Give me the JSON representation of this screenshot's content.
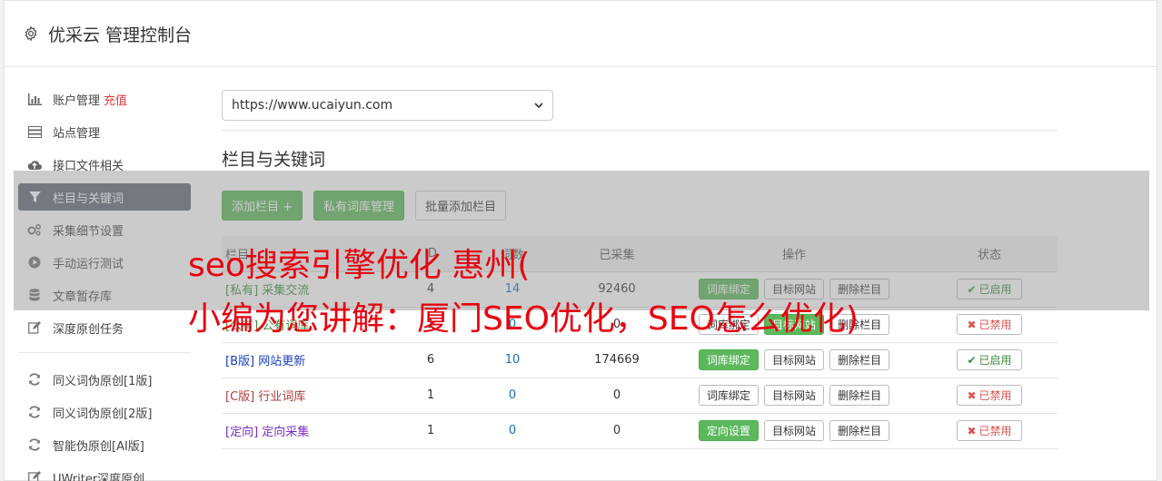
{
  "header": {
    "title": "优采云 管理控制台",
    "icon": "gear-icon"
  },
  "sidebar": {
    "items": [
      {
        "label": "账户管理",
        "extra": "充值",
        "icon": "bar-chart-icon"
      },
      {
        "label": "站点管理",
        "icon": "server-icon"
      },
      {
        "label": "接口文件相关",
        "icon": "cloud-upload-icon"
      },
      {
        "label": "栏目与关键词",
        "icon": "filter-icon",
        "active": true
      },
      {
        "label": "采集细节设置",
        "icon": "cogs-icon"
      },
      {
        "label": "手动运行测试",
        "icon": "play-circle-icon"
      },
      {
        "label": "文章暂存库",
        "icon": "database-icon"
      },
      {
        "label": "深度原创任务",
        "icon": "edit-icon"
      }
    ],
    "items2": [
      {
        "label": "同义词伪原创[1版]",
        "icon": "refresh-icon"
      },
      {
        "label": "同义词伪原创[2版]",
        "icon": "refresh-icon"
      },
      {
        "label": "智能伪原创[AI版]",
        "icon": "refresh-icon"
      },
      {
        "label": "UWriter深度原创",
        "icon": "edit-icon"
      }
    ]
  },
  "main": {
    "site_select": "https://www.ucaiyun.com",
    "section_title": "栏目与关键词",
    "buttons": {
      "add_column": "添加栏目 +",
      "private_lib": "私有词库管理",
      "batch_add": "批量添加栏目"
    },
    "table": {
      "headers": {
        "name": "栏目",
        "id": "ID",
        "count": "词数",
        "collected": "已采集",
        "ops": "操作",
        "status": "状态"
      },
      "rows": [
        {
          "tag": "[私有]",
          "name": "采集交流",
          "id": "4",
          "count": "14",
          "collected": "92460",
          "op1": "词库绑定",
          "op2": "目标网站",
          "op3": "删除栏目",
          "status": "已启用"
        },
        {
          "tag": "[公有]",
          "name": "公有词库",
          "id": "1",
          "count": "0",
          "collected": "0",
          "op1": "词库绑定",
          "op2": "目标网站",
          "op3": "删除栏目",
          "status": "已禁用"
        },
        {
          "tag": "[B版]",
          "name": "网站更新",
          "id": "6",
          "count": "10",
          "collected": "174669",
          "op1": "词库绑定",
          "op2": "目标网站",
          "op3": "删除栏目",
          "status": "已启用"
        },
        {
          "tag": "[C版]",
          "name": "行业词库",
          "id": "1",
          "count": "0",
          "collected": "0",
          "op1": "词库绑定",
          "op2": "目标网站",
          "op3": "删除栏目",
          "status": "已禁用"
        },
        {
          "tag": "[定向]",
          "name": "定向采集",
          "id": "1",
          "count": "0",
          "collected": "0",
          "op1": "定向设置",
          "op2": "目标网站",
          "op3": "删除栏目",
          "status": "已禁用"
        }
      ]
    }
  },
  "overlay": {
    "line1": "seo搜索引擎优化 惠州(",
    "line2": "小编为您讲解：厦门SEO优化，SEO怎么优化)"
  }
}
